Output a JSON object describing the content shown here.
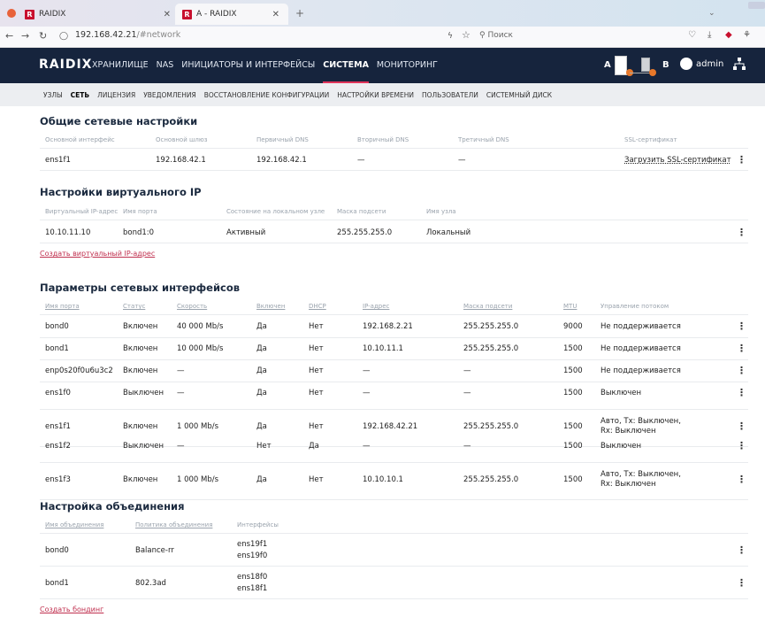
{
  "browser": {
    "tab1_title": "RAIDIX",
    "tab2_title": "A - RAIDIX",
    "url_host": "192.168.42.21",
    "url_path": "/#network",
    "search_placeholder": "Поиск"
  },
  "app": {
    "logo": "RAIDIX",
    "nav": [
      "ХРАНИЛИЩЕ",
      "NAS",
      "ИНИЦИАТОРЫ И ИНТЕРФЕЙСЫ",
      "СИСТЕМА",
      "МОНИТОРИНГ"
    ],
    "node_a": "A",
    "node_b": "B",
    "user": "admin"
  },
  "subnav": [
    "УЗЛЫ",
    "СЕТЬ",
    "ЛИЦЕНЗИЯ",
    "УВЕДОМЛЕНИЯ",
    "ВОССТАНОВЛЕНИЕ КОНФИГУРАЦИИ",
    "НАСТРОЙКИ ВРЕМЕНИ",
    "ПОЛЬЗОВАТЕЛИ",
    "СИСТЕМНЫЙ ДИСК"
  ],
  "general": {
    "title": "Общие сетевые настройки",
    "headers": [
      "Основной интерфейс",
      "Основной шлюз",
      "Первичный DNS",
      "Вторичный DNS",
      "Третичный DNS",
      "SSL-сертификат"
    ],
    "values": [
      "ens1f1",
      "192.168.42.1",
      "192.168.42.1",
      "—",
      "—"
    ],
    "ssl_link": "Загрузить SSL-сертификат"
  },
  "vip": {
    "title": "Настройки виртуального IP",
    "headers": [
      "Виртуальный IP-адрес",
      "Имя порта",
      "Состояние на локальном узле",
      "Маска подсети",
      "Имя узла"
    ],
    "values": [
      "10.10.11.10",
      "bond1:0",
      "Активный",
      "255.255.255.0",
      "Локальный"
    ],
    "create_link": "Создать виртуальный IP-адрес"
  },
  "ifaces": {
    "title": "Параметры сетевых интерфейсов",
    "headers": [
      "Имя порта",
      "Статус",
      "Скорость",
      "Включен",
      "DHCP",
      "IP-адрес",
      "Маска подсети",
      "MTU",
      "Управление потоком"
    ],
    "rows": [
      [
        "bond0",
        "Включен",
        "40 000 Mb/s",
        "Да",
        "Нет",
        "192.168.2.21",
        "255.255.255.0",
        "9000",
        "Не поддерживается",
        ""
      ],
      [
        "bond1",
        "Включен",
        "10 000 Mb/s",
        "Да",
        "Нет",
        "10.10.11.1",
        "255.255.255.0",
        "1500",
        "Не поддерживается",
        ""
      ],
      [
        "enp0s20f0u6u3c2",
        "Включен",
        "—",
        "Да",
        "Нет",
        "—",
        "—",
        "1500",
        "Не поддерживается",
        ""
      ],
      [
        "ens1f0",
        "Выключен",
        "—",
        "Да",
        "Нет",
        "—",
        "—",
        "1500",
        "Выключен",
        ""
      ],
      [
        "ens1f1",
        "Включен",
        "1 000 Mb/s",
        "Да",
        "Нет",
        "192.168.42.21",
        "255.255.255.0",
        "1500",
        "Авто, Tx: Выключен,",
        "Rx: Выключен"
      ],
      [
        "ens1f2",
        "Выключен",
        "—",
        "Нет",
        "Да",
        "—",
        "—",
        "1500",
        "Выключен",
        ""
      ],
      [
        "ens1f3",
        "Включен",
        "1 000 Mb/s",
        "Да",
        "Нет",
        "10.10.10.1",
        "255.255.255.0",
        "1500",
        "Авто, Tx: Выключен,",
        "Rx: Выключен"
      ]
    ]
  },
  "bond": {
    "title": "Настройка объединения",
    "headers": [
      "Имя объединения",
      "Политика объединения",
      "Интерфейсы"
    ],
    "rows": [
      [
        "bond0",
        "Balance-rr",
        "ens19f1",
        "ens19f0"
      ],
      [
        "bond1",
        "802.3ad",
        "ens18f0",
        "ens18f1"
      ]
    ],
    "create_link": "Создать бондинг"
  },
  "kebab": "⋮"
}
